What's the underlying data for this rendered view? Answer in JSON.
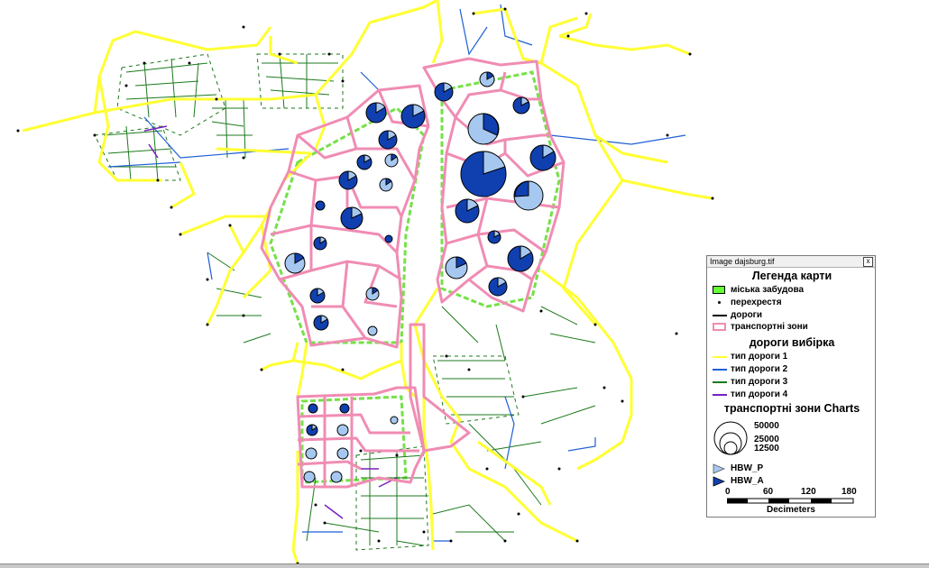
{
  "legend": {
    "window_title": "Image dajsburg.tif",
    "close_glyph": "x",
    "header1": "Легенда карти",
    "items1": [
      {
        "label": "міська забудова",
        "color": "#66ff33"
      },
      {
        "label": "перехрестя",
        "color": "#000000"
      },
      {
        "label": "дороги",
        "color": "#000000"
      },
      {
        "label": "транспортні зони",
        "color": "#f08cb4"
      }
    ],
    "header2": "дороги вибірка",
    "roads": [
      {
        "label": "тип дороги 1",
        "color": "#ffff33"
      },
      {
        "label": "тип дороги 2",
        "color": "#1f5fd6"
      },
      {
        "label": "тип дороги 3",
        "color": "#1c7a1c"
      },
      {
        "label": "тип дороги 4",
        "color": "#7a1fbf"
      }
    ],
    "header3": "транспортні зони Charts",
    "circle_values": [
      "50000",
      "25000",
      "12500"
    ],
    "pie_series": [
      {
        "label": "HBW_P",
        "color": "#a6c8f0"
      },
      {
        "label": "HBW_A",
        "color": "#1040b0"
      }
    ],
    "scale_ticks": [
      "0",
      "60",
      "120",
      "180"
    ],
    "scale_unit": "Decimeters"
  }
}
